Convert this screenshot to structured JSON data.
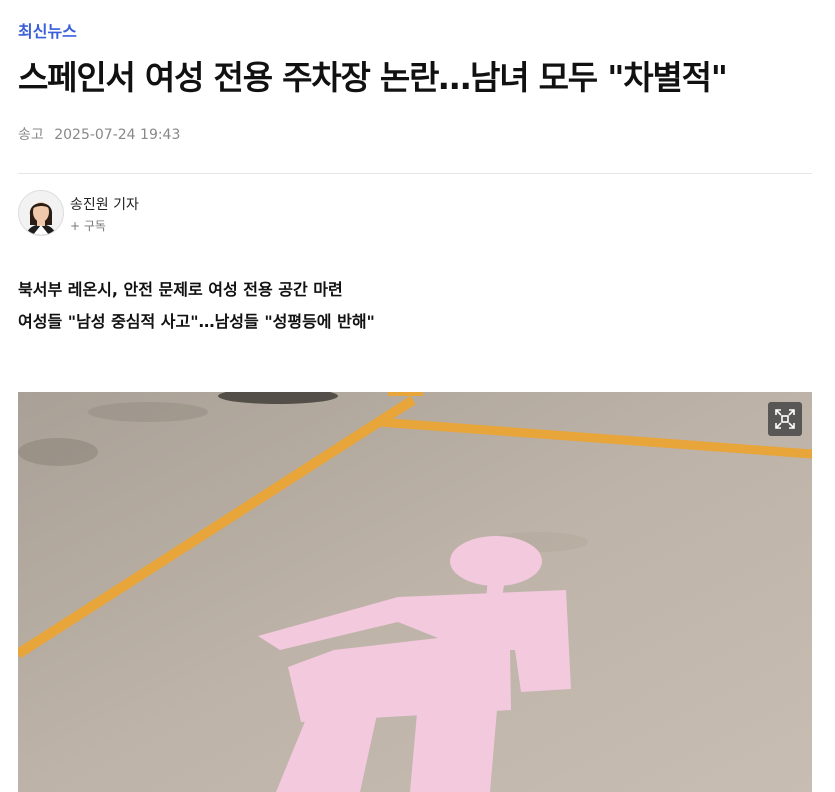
{
  "section": {
    "label": "최신뉴스"
  },
  "article": {
    "title": "스페인서 여성 전용 주차장 논란…남녀 모두 \"차별적\"",
    "sent_label": "송고",
    "sent_datetime": "2025-07-24 19:43",
    "summary": [
      "북서부 레온시, 안전 문제로 여성 전용 공간 마련",
      "여성들 \"남성 중심적 사고\"…남성들 \"성평등에 반해\""
    ]
  },
  "reporter": {
    "name": "송진원 기자",
    "subscribe_label": "+ 구독"
  },
  "photo": {
    "expand_icon": "expand-icon"
  },
  "colors": {
    "accent": "#3a5fd9",
    "pink_marking": "#f3c9dd",
    "yellow_line": "#e8a53a"
  }
}
